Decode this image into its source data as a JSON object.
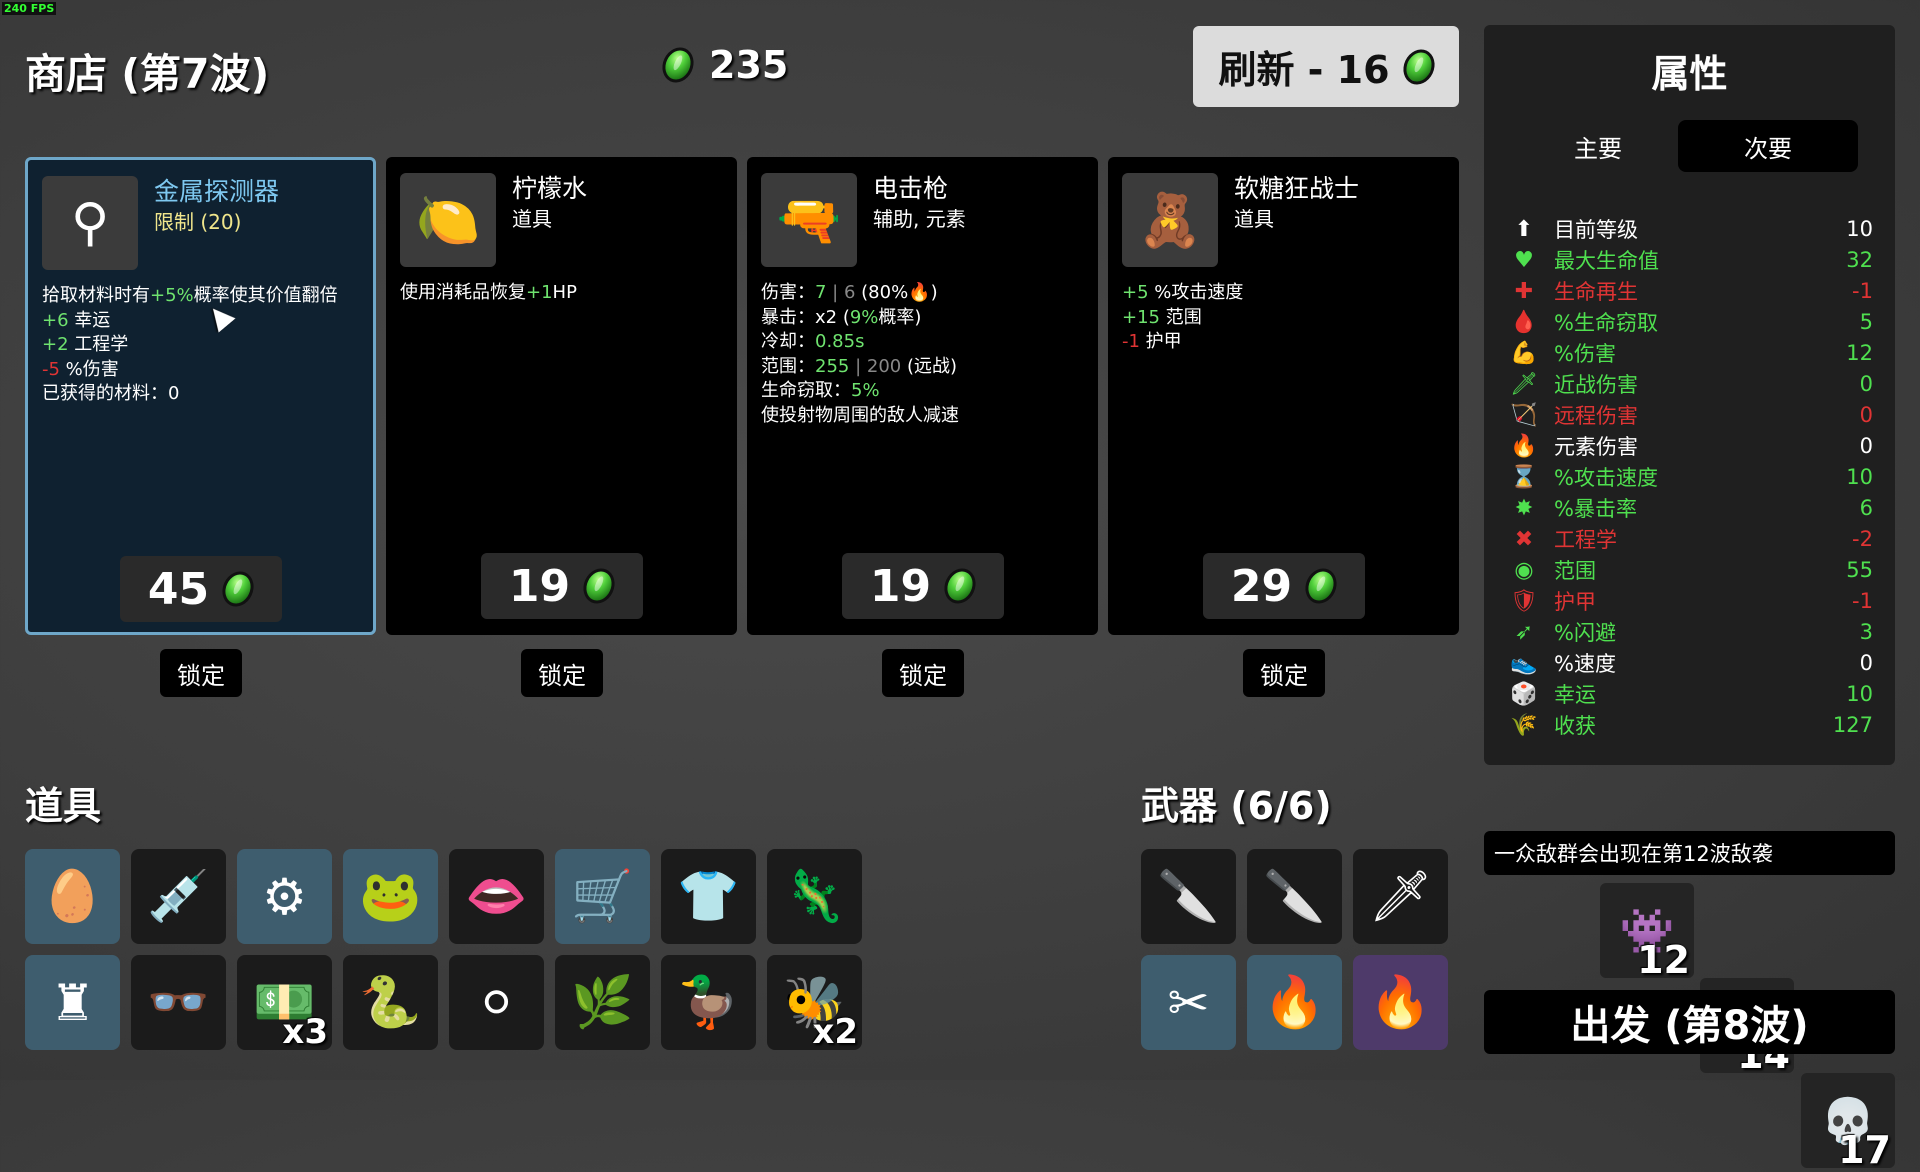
{
  "fps": "240 FPS",
  "shop_title": "商店 (第7波)",
  "materials": "235",
  "refresh_label": "刷新 - 16",
  "shop_cards": [
    {
      "name": "金属探测器",
      "name_color": "#7ec8f0",
      "type": "限制 (20)",
      "type_color": "#f0e68c",
      "icon": "⚲",
      "price": "45",
      "desc": [
        [
          "拾取材料时有",
          ""
        ],
        [
          "+5%",
          "g"
        ],
        [
          "概率使其价值翻倍",
          ""
        ]
      ],
      "lines": [
        [
          [
            "+6",
            "g"
          ],
          [
            " 幸运",
            ""
          ]
        ],
        [
          [
            "+2",
            "g"
          ],
          [
            " 工程学",
            ""
          ]
        ],
        [
          [
            "-5",
            "r"
          ],
          [
            " %伤害",
            ""
          ]
        ],
        [
          [
            "已获得的材料：0",
            ""
          ]
        ]
      ]
    },
    {
      "name": "柠檬水",
      "name_color": "#ffffff",
      "type": "道具",
      "type_color": "#ffffff",
      "icon": "🍋",
      "price": "19",
      "lines": [
        [
          [
            "使用消耗品恢复",
            ""
          ],
          [
            "+1",
            "g"
          ],
          [
            "HP",
            ""
          ]
        ]
      ]
    },
    {
      "name": "电击枪",
      "name_color": "#ffffff",
      "type": "辅助, 元素",
      "type_color": "#ffffff",
      "icon": "🔫",
      "price": "19",
      "lines": [
        [
          [
            "伤害：",
            ""
          ],
          [
            "7",
            "g"
          ],
          [
            " | 6 ",
            "gr"
          ],
          [
            "(80%🔥)",
            ""
          ]
        ],
        [
          [
            "暴击：x2 (",
            ""
          ],
          [
            "9%",
            "g"
          ],
          [
            "概率)",
            ""
          ]
        ],
        [
          [
            "冷却：",
            ""
          ],
          [
            "0.85s",
            "g"
          ]
        ],
        [
          [
            "范围：",
            ""
          ],
          [
            "255",
            "g"
          ],
          [
            " | 200 ",
            "gr"
          ],
          [
            "(远战)",
            ""
          ]
        ],
        [
          [
            "生命窃取：",
            ""
          ],
          [
            "5%",
            "g"
          ]
        ],
        [
          [
            "使投射物周围的敌人减速",
            ""
          ]
        ]
      ]
    },
    {
      "name": "软糖狂战士",
      "name_color": "#ffffff",
      "type": "道具",
      "type_color": "#ffffff",
      "icon": "🧸",
      "price": "29",
      "lines": [
        [
          [
            "+5",
            "g"
          ],
          [
            " %攻击速度",
            ""
          ]
        ],
        [
          [
            "+15",
            "g"
          ],
          [
            " 范围",
            ""
          ]
        ],
        [
          [
            "-1",
            "r"
          ],
          [
            " 护甲",
            ""
          ]
        ]
      ]
    }
  ],
  "lock_label": "锁定",
  "stats": {
    "title": "属性",
    "tab_primary": "主要",
    "tab_secondary": "次要",
    "rows": [
      {
        "icon": "⬆",
        "label": "目前等级",
        "value": "10",
        "color": "#ffffff"
      },
      {
        "icon": "♥",
        "label": "最大生命值",
        "value": "32",
        "color": "#4fe04f"
      },
      {
        "icon": "✚",
        "label": "生命再生",
        "value": "-1",
        "color": "#e03434"
      },
      {
        "icon": "🩸",
        "label": "%生命窃取",
        "value": "5",
        "color": "#4fe04f"
      },
      {
        "icon": "💪",
        "label": "%伤害",
        "value": "12",
        "color": "#4fe04f"
      },
      {
        "icon": "🗡",
        "label": "近战伤害",
        "value": "0",
        "color": "#4fe04f"
      },
      {
        "icon": "🏹",
        "label": "远程伤害",
        "value": "0",
        "color": "#e03434"
      },
      {
        "icon": "🔥",
        "label": "元素伤害",
        "value": "0",
        "color": "#ffffff"
      },
      {
        "icon": "⌛",
        "label": "%攻击速度",
        "value": "10",
        "color": "#4fe04f"
      },
      {
        "icon": "✸",
        "label": "%暴击率",
        "value": "6",
        "color": "#4fe04f"
      },
      {
        "icon": "✖",
        "label": "工程学",
        "value": "-2",
        "color": "#e03434"
      },
      {
        "icon": "◉",
        "label": "范围",
        "value": "55",
        "color": "#4fe04f"
      },
      {
        "icon": "🛡",
        "label": "护甲",
        "value": "-1",
        "color": "#e03434"
      },
      {
        "icon": "➶",
        "label": "%闪避",
        "value": "3",
        "color": "#4fe04f"
      },
      {
        "icon": "👟",
        "label": "%速度",
        "value": "0",
        "color": "#ffffff"
      },
      {
        "icon": "🎲",
        "label": "幸运",
        "value": "10",
        "color": "#4fe04f"
      },
      {
        "icon": "🌾",
        "label": "收获",
        "value": "127",
        "color": "#4fe04f"
      }
    ]
  },
  "items_title": "道具",
  "items": [
    {
      "icon": "🥚",
      "bg": "blue",
      "count": ""
    },
    {
      "icon": "💉",
      "bg": "dark",
      "count": ""
    },
    {
      "icon": "⚙",
      "bg": "blue",
      "count": ""
    },
    {
      "icon": "🐸",
      "bg": "blue",
      "count": ""
    },
    {
      "icon": "👄",
      "bg": "dark",
      "count": ""
    },
    {
      "icon": "🛒",
      "bg": "blue",
      "count": ""
    },
    {
      "icon": "👕",
      "bg": "dark",
      "count": ""
    },
    {
      "icon": "🦎",
      "bg": "dark",
      "count": ""
    },
    {
      "icon": "♜",
      "bg": "blue",
      "count": ""
    },
    {
      "icon": "👓",
      "bg": "dark",
      "count": ""
    },
    {
      "icon": "💵",
      "bg": "dark",
      "count": "x3"
    },
    {
      "icon": "🐍",
      "bg": "dark",
      "count": ""
    },
    {
      "icon": "⚪",
      "bg": "dark",
      "count": ""
    },
    {
      "icon": "🌿",
      "bg": "dark",
      "count": ""
    },
    {
      "icon": "🦆",
      "bg": "dark",
      "count": ""
    },
    {
      "icon": "🐝",
      "bg": "dark",
      "count": "x2"
    }
  ],
  "weapons_title": "武器 (6/6)",
  "weapons": [
    {
      "icon": "🔪",
      "bg": "dark"
    },
    {
      "icon": "🔪",
      "bg": "dark"
    },
    {
      "icon": "🗡",
      "bg": "dark"
    },
    {
      "icon": "✂",
      "bg": "blue"
    },
    {
      "icon": "🔥",
      "bg": "blue"
    },
    {
      "icon": "🔥",
      "bg": "purple"
    }
  ],
  "wave_info": "一众敌群会出现在第12波敌袭",
  "enemies": [
    {
      "icon": "👾",
      "count": "12"
    },
    {
      "icon": "💀",
      "count": "14"
    },
    {
      "icon": "💀",
      "count": "17"
    }
  ],
  "go_label": "出发 (第8波)"
}
